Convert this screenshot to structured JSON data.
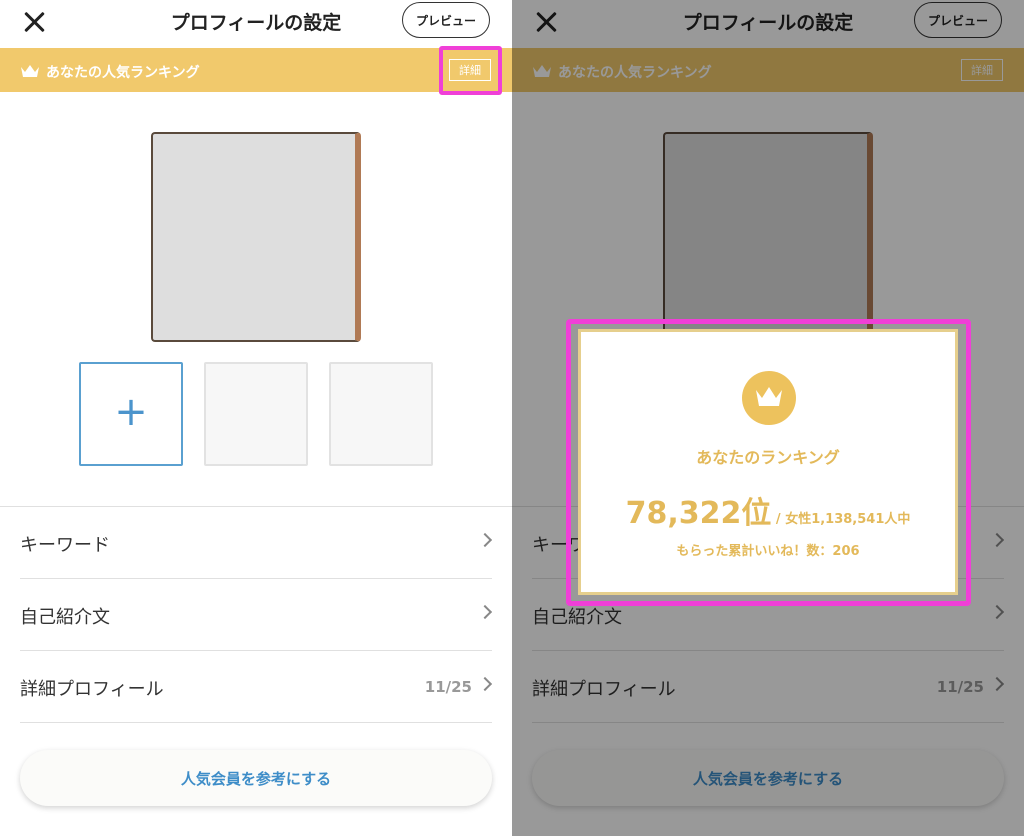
{
  "header": {
    "title": "プロフィールの設定",
    "preview_label": "プレビュー"
  },
  "ranking_bar": {
    "label": "あなたの人気ランキング",
    "detail_label": "詳細"
  },
  "photo_slots": {
    "add_symbol": "+"
  },
  "menu": [
    {
      "label": "キーワード"
    },
    {
      "label": "自己紹介文"
    },
    {
      "label": "詳細プロフィール",
      "count": "11/25"
    }
  ],
  "reference_button": "人気会員を参考にする",
  "modal": {
    "title": "あなたのランキング",
    "rank": "78,322位",
    "total": " / 女性1,138,541人中",
    "likes": "もらった累計いいね！数：206"
  },
  "colors": {
    "gold": "#f1c96c",
    "accent_blue": "#3e8dc8",
    "highlight": "#f03fd7"
  }
}
